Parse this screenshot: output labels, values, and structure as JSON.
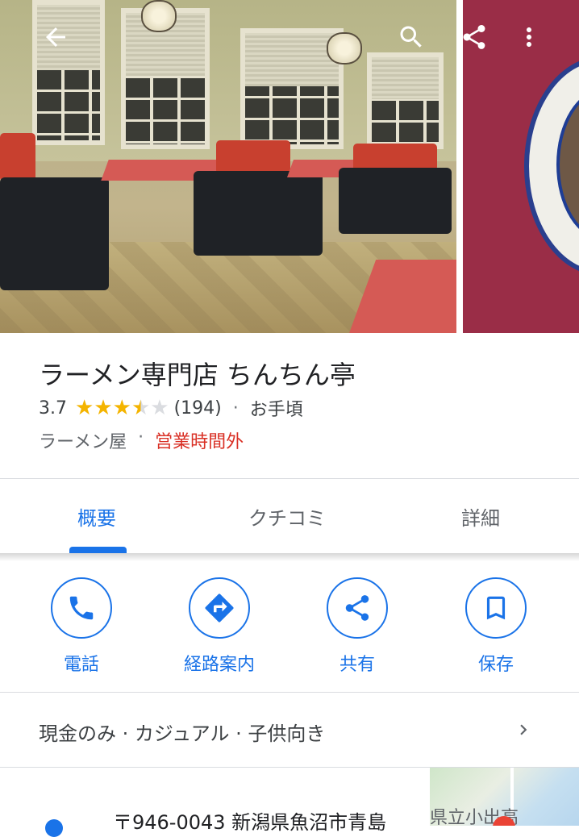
{
  "place": {
    "name": "ラーメン専門店 ちんちん亭",
    "rating": "3.7",
    "rating_value": 3.7,
    "review_count": "(194)",
    "price": "お手頃",
    "dot": "·",
    "category": "ラーメン屋",
    "status": "営業時間外"
  },
  "tabs": [
    {
      "label": "概要",
      "active": true
    },
    {
      "label": "クチコミ",
      "active": false
    },
    {
      "label": "詳細",
      "active": false
    }
  ],
  "actions": [
    {
      "label": "電話",
      "icon": "phone-icon"
    },
    {
      "label": "経路案内",
      "icon": "directions-icon"
    },
    {
      "label": "共有",
      "icon": "share-icon"
    },
    {
      "label": "保存",
      "icon": "bookmark-icon"
    }
  ],
  "attributes": "現金のみ · カジュアル · 子供向き",
  "address": "〒946-0043 新潟県魚沼市青島",
  "map_label": "県立小出高",
  "colors": {
    "accent": "#1a73e8",
    "star": "#f4b400",
    "closed": "#d93025"
  }
}
